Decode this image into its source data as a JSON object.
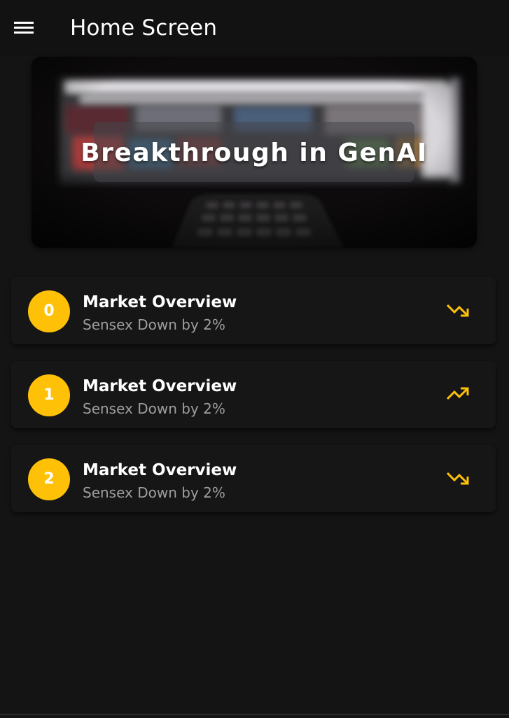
{
  "app_bar": {
    "title": "Home Screen",
    "menu_icon": "hamburger-menu-icon"
  },
  "banner": {
    "caption": "Breakthrough in GenAI",
    "image": "tv-screen-with-remote-photo"
  },
  "cards": [
    {
      "index": "0",
      "title": "Market Overview",
      "subtitle": "Sensex Down by 2%",
      "trend_icon": "trending-down-icon"
    },
    {
      "index": "1",
      "title": "Market Overview",
      "subtitle": "Sensex Down by 2%",
      "trend_icon": "trending-up-icon"
    },
    {
      "index": "2",
      "title": "Market Overview",
      "subtitle": "Sensex Down by 2%",
      "trend_icon": "trending-down-icon"
    }
  ],
  "colors": {
    "background": "#141414",
    "accent": "#ffc107",
    "card": "#161616",
    "subtitle": "#9e9e9e"
  }
}
